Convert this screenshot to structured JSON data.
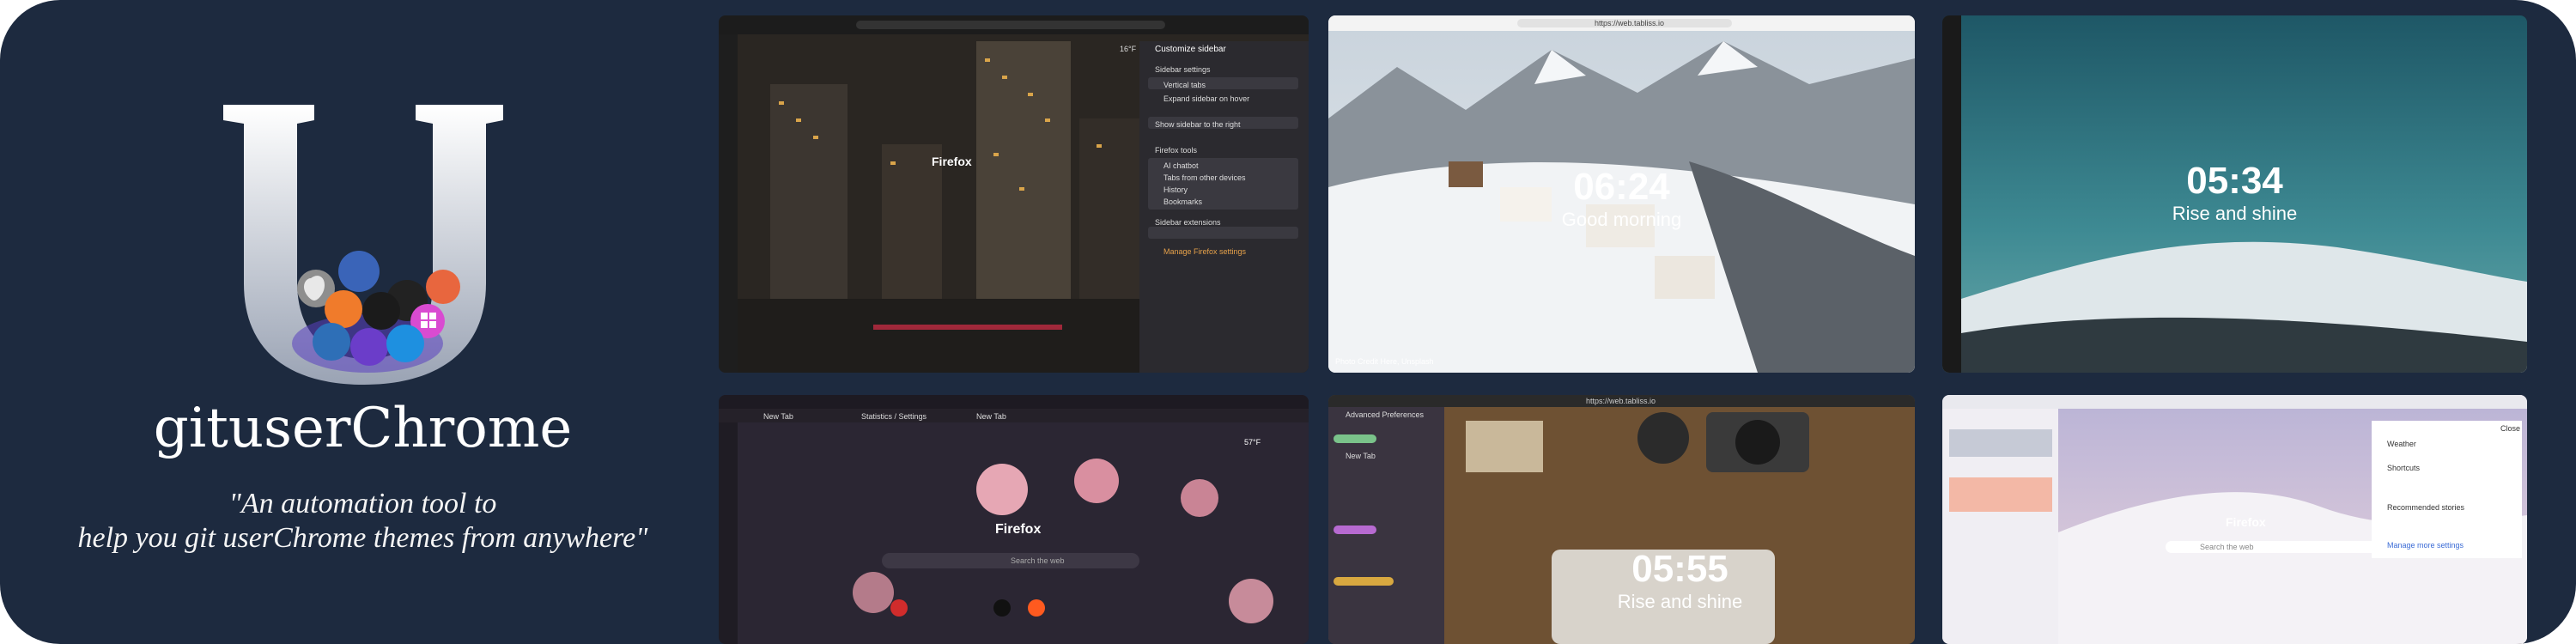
{
  "brand": {
    "title": "gituserChrome",
    "tagline_1": "\"An automation tool to",
    "tagline_2": "help you git userChrome themes from anywhere\""
  },
  "colors": {
    "banner_bg": "#1d2a3f",
    "logo_gradient_top": "#ffffff",
    "logo_gradient_bottom": "#9aa3b4"
  },
  "screenshots": [
    {
      "id": "city-sidebar",
      "firefox_label": "Firefox",
      "weather": "16°F",
      "panel_title": "Customize sidebar",
      "panel_items": [
        "Sidebar settings",
        "Vertical tabs",
        "Expand sidebar on hover",
        "Show sidebar to the right",
        "Firefox tools",
        "AI chatbot",
        "Tabs from other devices",
        "History",
        "Bookmarks",
        "Sidebar extensions",
        "Manage Firefox settings"
      ]
    },
    {
      "id": "snow-village",
      "time": "06:24",
      "greeting": "Good morning",
      "url": "https://web.tabliss.io",
      "credit": "Photo Credit Here, Unsplash"
    },
    {
      "id": "teal-hills",
      "time": "05:34",
      "greeting": "Rise and shine"
    },
    {
      "id": "roses",
      "firefox_label": "Firefox",
      "weather": "57°F",
      "search_placeholder": "Search the web",
      "tab_labels": [
        "New Tab",
        "Statistics / Settings",
        "New Tab"
      ]
    },
    {
      "id": "desk-camera",
      "time": "05:55",
      "greeting": "Rise and shine",
      "url": "https://web.tabliss.io",
      "sidebar_header": "Advanced Preferences",
      "sidebar_item": "New Tab"
    },
    {
      "id": "pink-mountains",
      "firefox_label": "Firefox",
      "search_placeholder": "Search the web",
      "panel_items": [
        "Weather",
        "Shortcuts",
        "Recommended stories",
        "Manage more settings"
      ],
      "close_label": "Close"
    }
  ]
}
